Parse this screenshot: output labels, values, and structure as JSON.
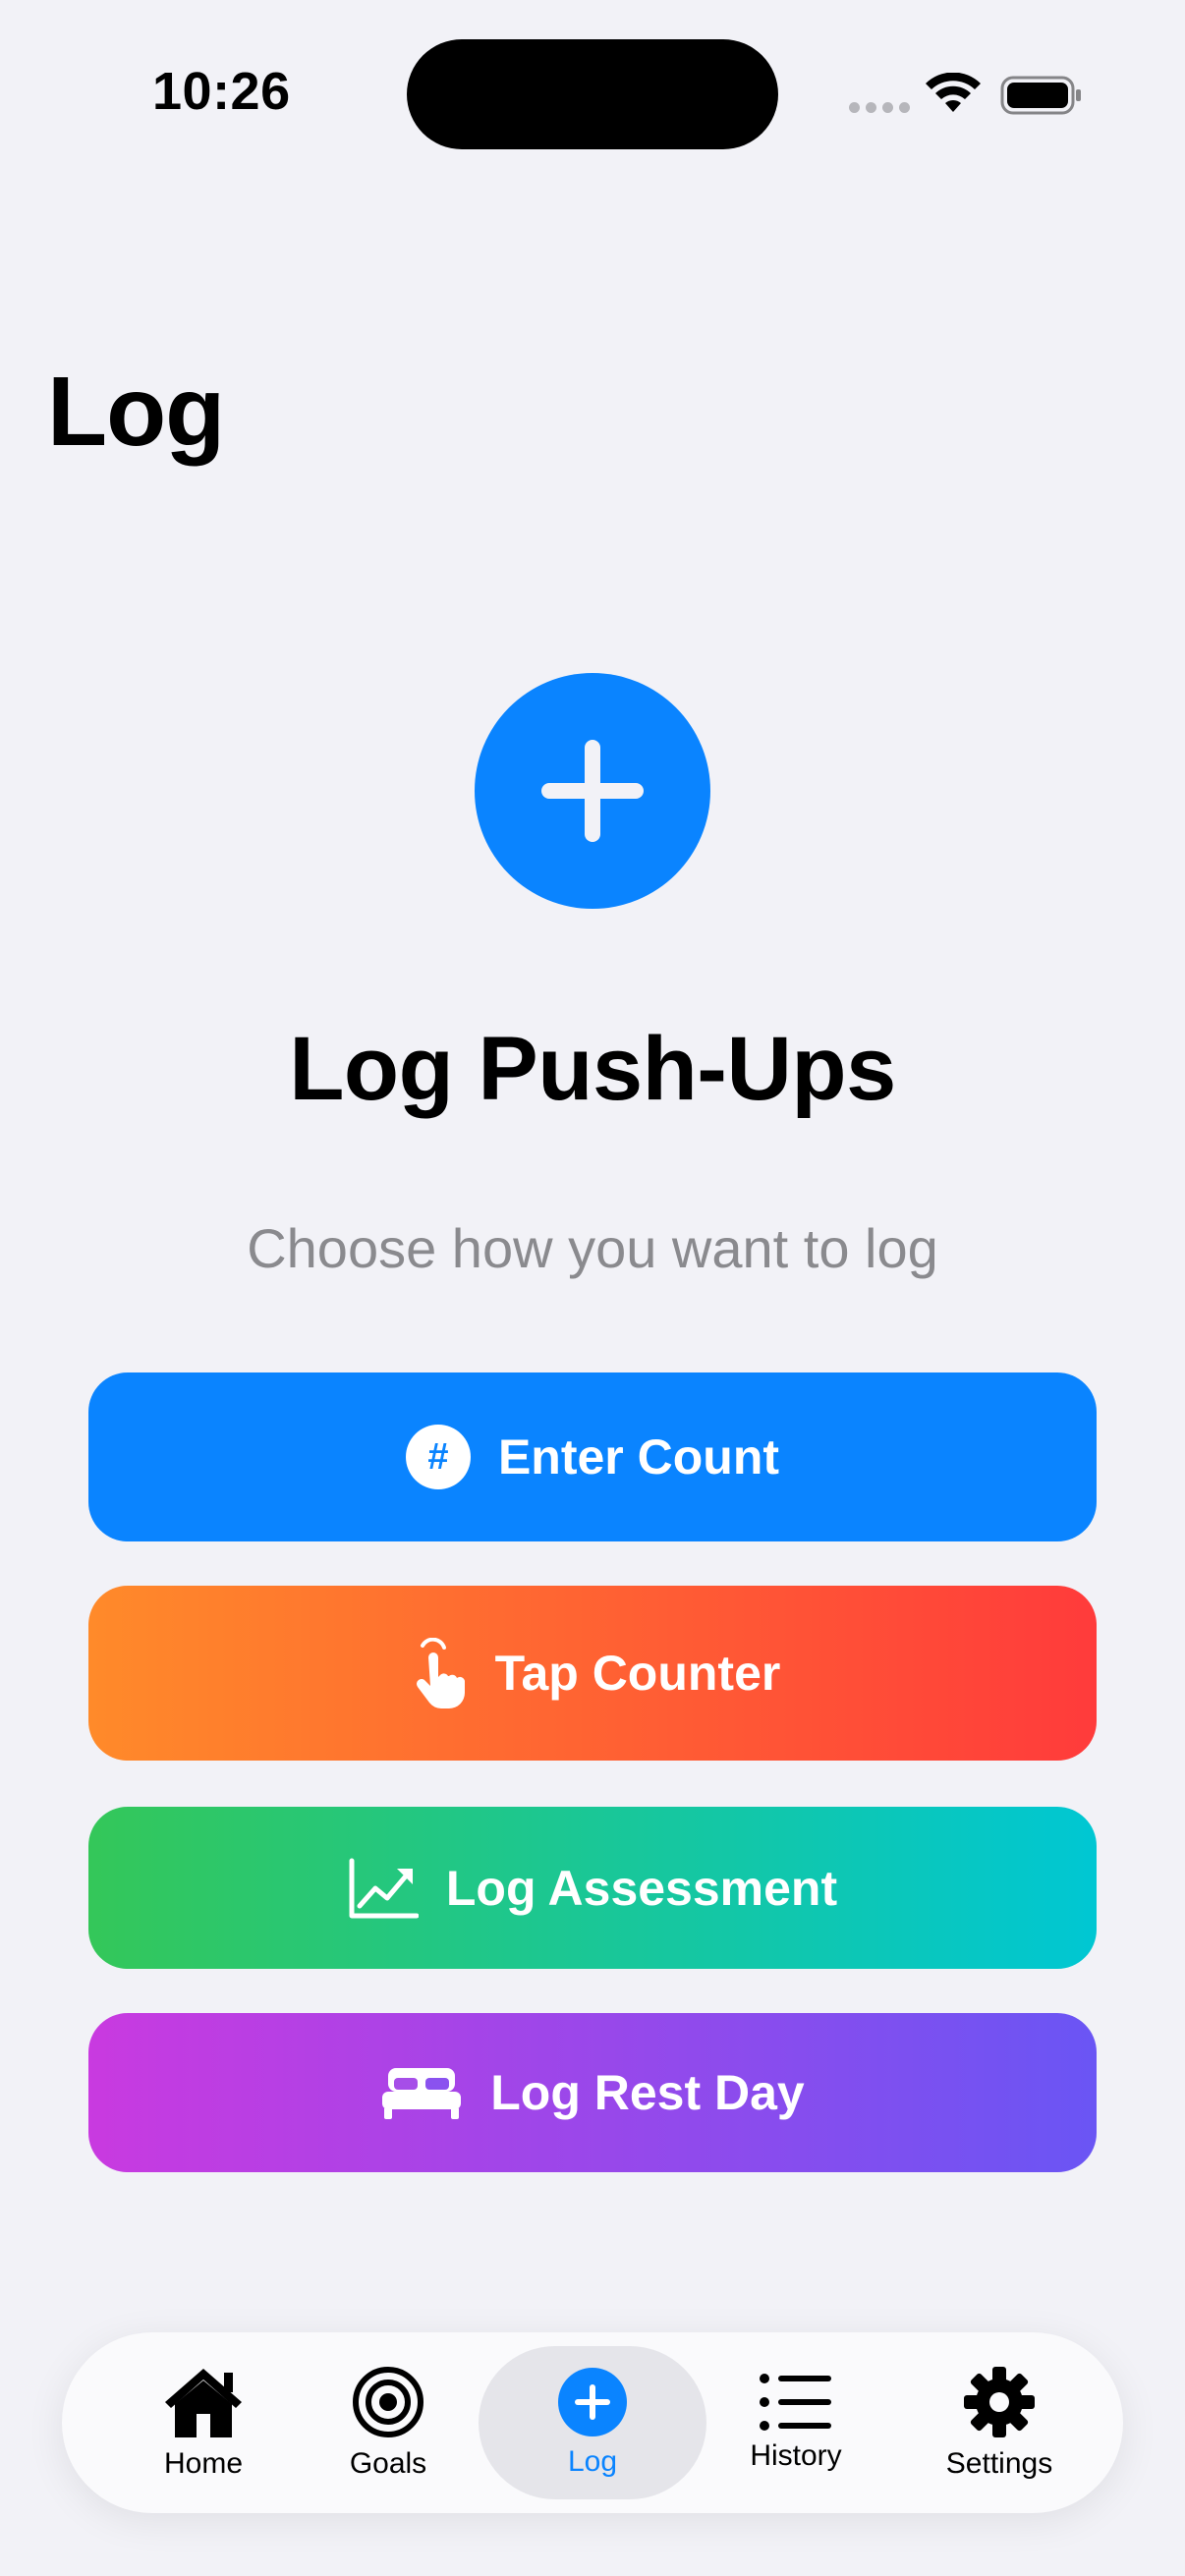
{
  "status_bar": {
    "time": "10:26"
  },
  "page": {
    "title": "Log"
  },
  "hero": {
    "icon": "plus-circle-icon",
    "heading": "Log Push-Ups",
    "subtitle": "Choose how you want to log"
  },
  "options": [
    {
      "label": "Enter Count",
      "icon": "number-icon",
      "color": "#0A84FF"
    },
    {
      "label": "Tap Counter",
      "icon": "hand-tap-icon",
      "colors": [
        "#FF8A2A",
        "#FF3B3B"
      ]
    },
    {
      "label": "Log Assessment",
      "icon": "chart-trend-icon",
      "colors": [
        "#34C759",
        "#00C7D3"
      ]
    },
    {
      "label": "Log Rest Day",
      "icon": "bed-icon",
      "colors": [
        "#C93AE0",
        "#6A55F4"
      ]
    }
  ],
  "tabs": [
    {
      "label": "Home",
      "icon": "house-icon"
    },
    {
      "label": "Goals",
      "icon": "target-icon"
    },
    {
      "label": "Log",
      "icon": "plus-circle-icon",
      "active": true
    },
    {
      "label": "History",
      "icon": "list-icon"
    },
    {
      "label": "Settings",
      "icon": "gear-icon"
    }
  ],
  "colors": {
    "accent": "#0A84FF",
    "background": "#F2F2F7",
    "secondary_text": "#8A8A8E"
  }
}
